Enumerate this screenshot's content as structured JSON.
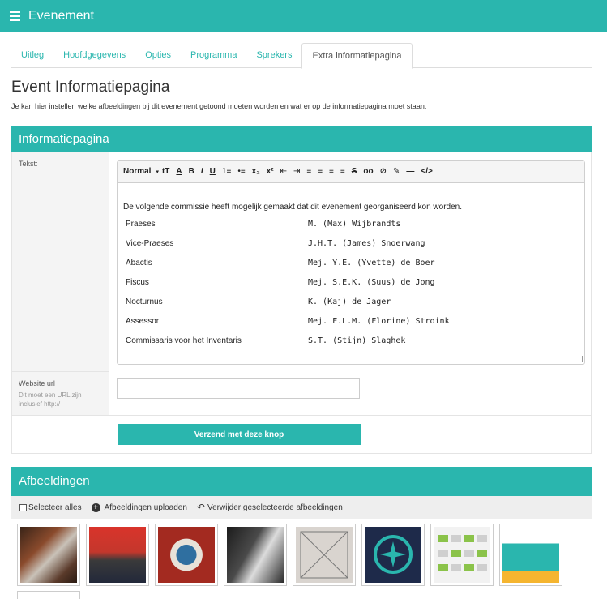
{
  "app": {
    "title": "Evenement"
  },
  "tabs": [
    {
      "label": "Uitleg"
    },
    {
      "label": "Hoofdgegevens"
    },
    {
      "label": "Opties"
    },
    {
      "label": "Programma"
    },
    {
      "label": "Sprekers"
    },
    {
      "label": "Extra informatiepagina"
    }
  ],
  "page": {
    "title": "Event Informatiepagina",
    "description": "Je kan hier instellen welke afbeeldingen bij dit evenement getoond moeten worden en wat er op de informatiepagina moet staan."
  },
  "info_panel": {
    "title": "Informatiepagina",
    "tekst_label": "Tekst:",
    "toolbar": {
      "format": "Normal",
      "tools": [
        "tT",
        "A",
        "B",
        "I",
        "U",
        "1≡",
        "•≡",
        "x₂",
        "x²",
        "⇤",
        "⇥",
        "≡",
        "≡",
        "≡",
        "≡",
        "S",
        "oo",
        "⊘",
        "✎",
        "—",
        "</>"
      ]
    },
    "editor": {
      "intro": "De volgende commissie heeft mogelijk gemaakt dat dit evenement georganiseerd kon worden.",
      "commissie": [
        {
          "role": "Praeses",
          "name": "M. (Max) Wijbrandts"
        },
        {
          "role": "Vice-Praeses",
          "name": "J.H.T. (James) Snoerwang"
        },
        {
          "role": "Abactis",
          "name": "Mej. Y.E. (Yvette) de Boer"
        },
        {
          "role": "Fiscus",
          "name": "Mej. S.E.K. (Suus) de Jong"
        },
        {
          "role": "Nocturnus",
          "name": "K. (Kaj) de Jager"
        },
        {
          "role": "Assessor",
          "name": "Mej. F.L.M. (Florine) Stroink"
        },
        {
          "role": "Commissaris voor het Inventaris",
          "name": "S.T. (Stijn) Slaghek"
        }
      ]
    },
    "website_label": "Website url",
    "website_hint": "Dit moet een URL zijn inclusief http://",
    "website_value": "",
    "submit_label": "Verzend met deze knop"
  },
  "images_panel": {
    "title": "Afbeeldingen",
    "select_all": "Selecteer alles",
    "upload": "Afbeeldingen uploaden",
    "delete_selected": "Verwijder geselecteerde afbeeldingen",
    "thumbnails": [
      "photo-theatre",
      "photo-group",
      "photo-crest",
      "photo-party",
      "photo-drawing",
      "logo-compass",
      "screenshot-grid",
      "screenshot-app"
    ]
  },
  "colors": {
    "accent": "#2ab6ae"
  }
}
